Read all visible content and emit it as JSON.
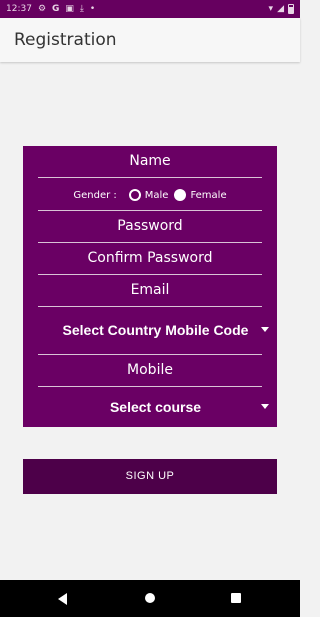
{
  "status_bar": {
    "time": "12:37",
    "left_icons": [
      "gear-icon",
      "google-icon",
      "image-icon",
      "download-icon",
      "dot-icon"
    ],
    "right_icons": [
      "wifi-icon",
      "signal-icon",
      "battery-icon"
    ]
  },
  "app_bar": {
    "title": "Registration"
  },
  "form": {
    "name_placeholder": "Name",
    "gender_label": "Gender :",
    "gender_options": [
      "Male",
      "Female"
    ],
    "password_placeholder": "Password",
    "confirm_password_placeholder": "Confirm Password",
    "email_placeholder": "Email",
    "country_code_select": "Select Country Mobile Code",
    "mobile_placeholder": "Mobile",
    "course_select": "Select course"
  },
  "signup_button": {
    "label": "SIGN UP"
  },
  "colors": {
    "primary": "#6a0064",
    "primary_dark": "#4d0049",
    "background": "#f2f2f2"
  }
}
